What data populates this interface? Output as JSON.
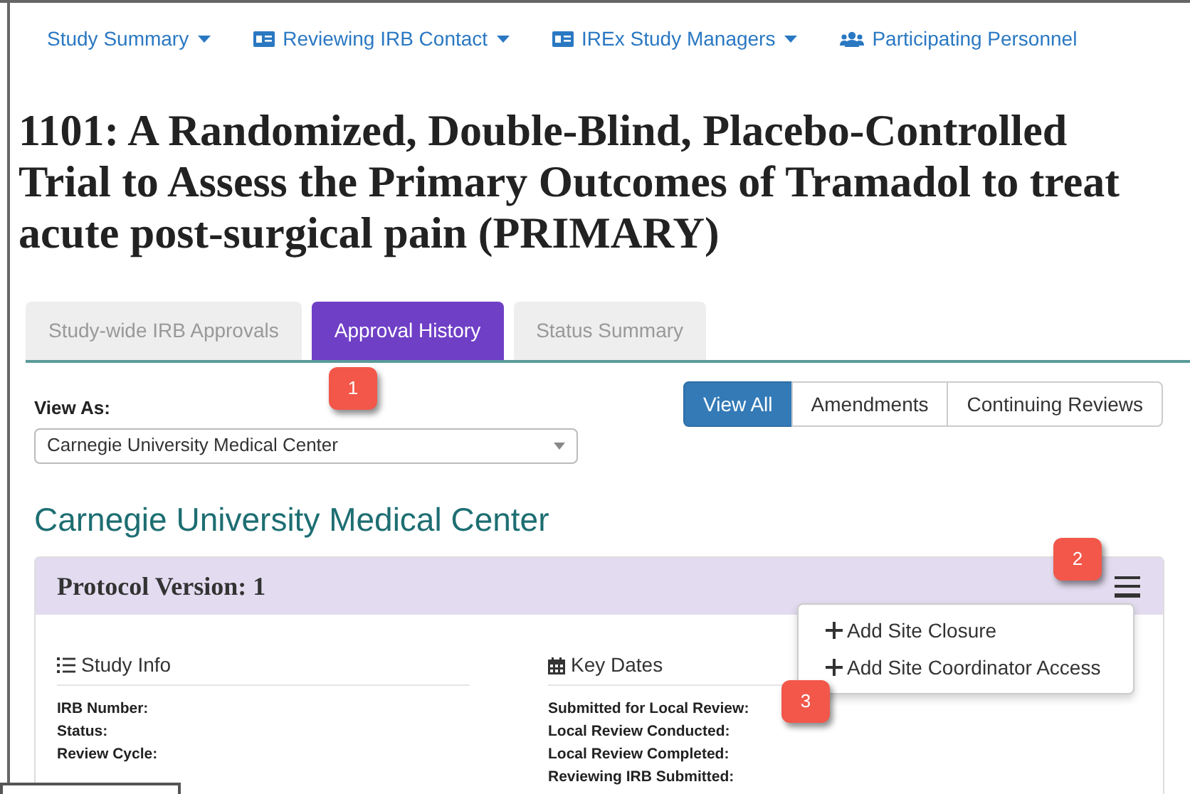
{
  "nav": [
    {
      "label": "Study Summary",
      "kind": "plain",
      "dropdown": true
    },
    {
      "label": "Reviewing IRB Contact",
      "kind": "card",
      "dropdown": true
    },
    {
      "label": "IREx Study Managers",
      "kind": "card",
      "dropdown": true
    },
    {
      "label": "Participating Personnel",
      "kind": "users",
      "dropdown": false
    }
  ],
  "title": "1101: A Randomized, Double-Blind, Placebo-Controlled Trial to Assess the Primary Outcomes of Tramadol to treat acute post-surgical pain (PRIMARY)",
  "tabs": [
    {
      "label": "Study-wide IRB Approvals",
      "selected": false
    },
    {
      "label": "Approval History",
      "selected": true
    },
    {
      "label": "Status Summary",
      "selected": false
    }
  ],
  "view_as": {
    "label": "View As:",
    "value": "Carnegie University Medical Center"
  },
  "filters": [
    {
      "label": "View All",
      "selected": true
    },
    {
      "label": "Amendments",
      "selected": false
    },
    {
      "label": "Continuing Reviews",
      "selected": false
    }
  ],
  "site_heading": "Carnegie University Medical Center",
  "panel": {
    "title": "Protocol Version: 1",
    "sections": [
      {
        "heading": "Study Info",
        "kind": "list",
        "fields": [
          "IRB Number:",
          "Status:",
          "Review Cycle:"
        ]
      },
      {
        "heading": "Key Dates",
        "kind": "calendar",
        "fields": [
          "Submitted for Local Review:",
          "Local Review Conducted:",
          "Local Review Completed:",
          "Reviewing IRB Submitted:"
        ]
      }
    ]
  },
  "menu": {
    "expanded": true,
    "items": [
      "Add Site Closure",
      "Add Site Coordinator Access"
    ]
  },
  "callouts": [
    "1",
    "2",
    "3"
  ]
}
